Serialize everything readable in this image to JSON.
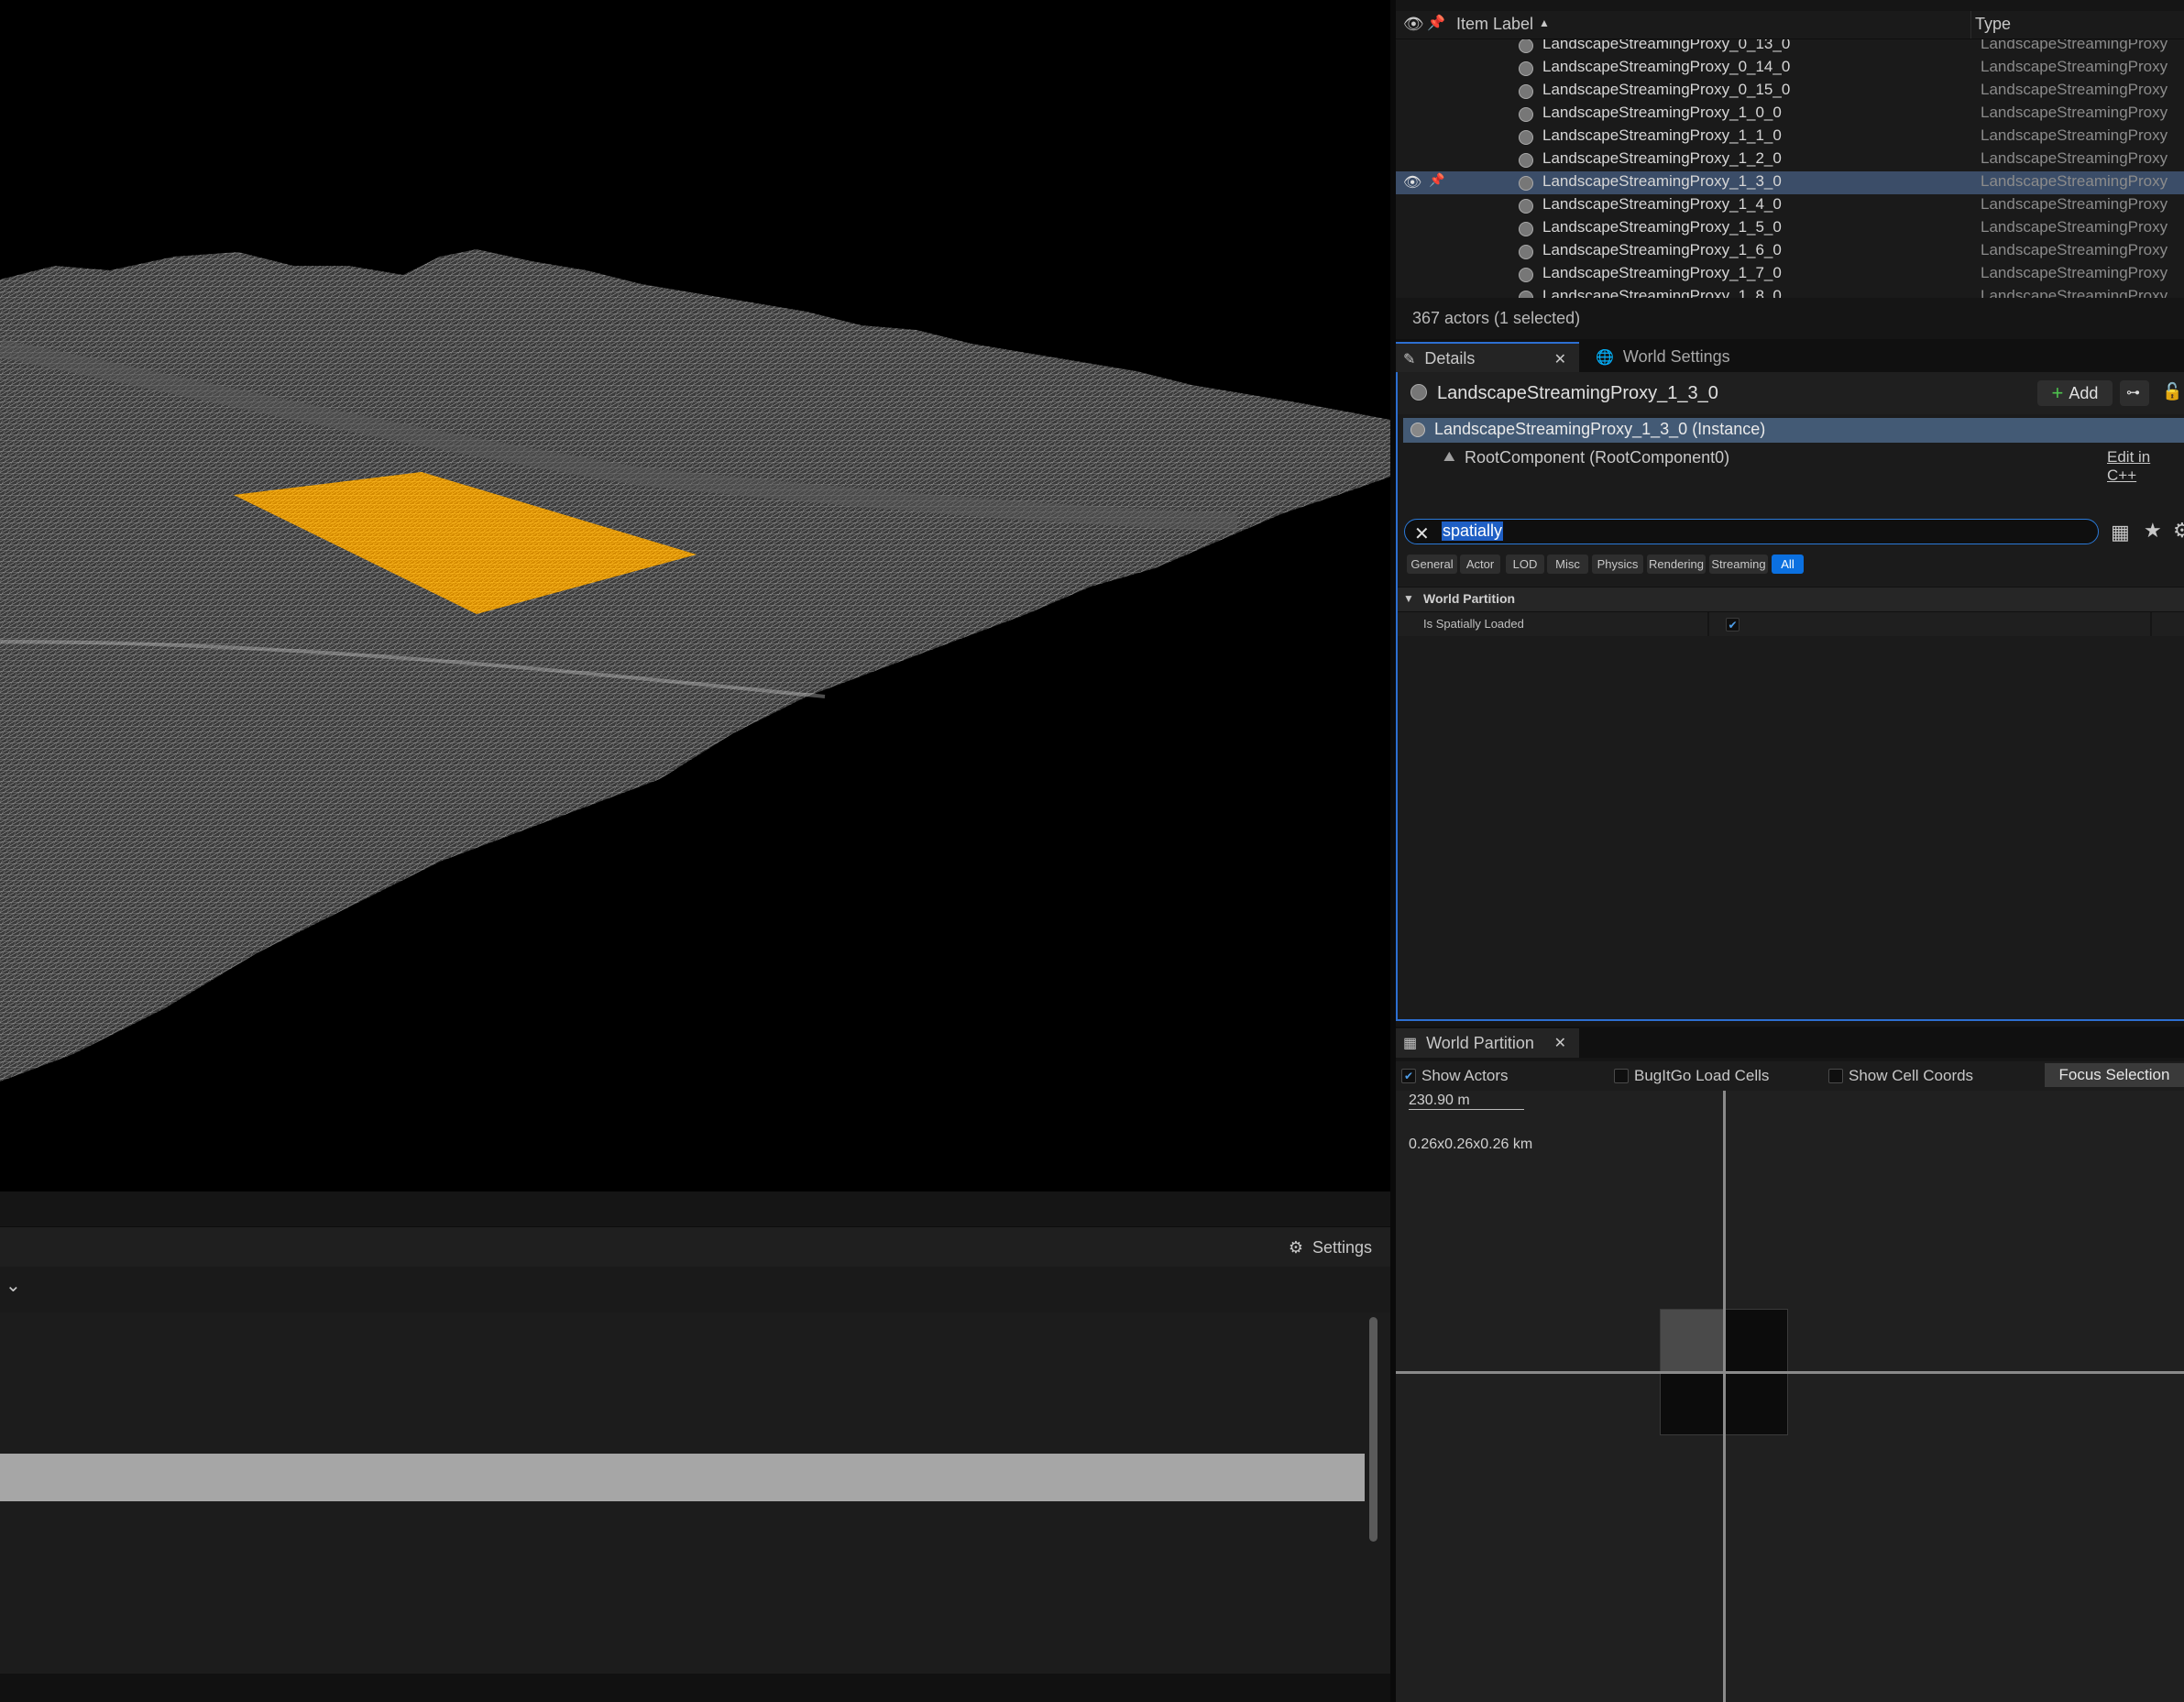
{
  "viewport": {
    "colors": {
      "wireframe": "#9a9a9a",
      "selection": "#f0a010",
      "background": "#000000"
    }
  },
  "bottom_panel": {
    "settings_label": "Settings",
    "filter_chevron": "⌄"
  },
  "outliner": {
    "col_item_label": "Item Label",
    "col_type": "Type",
    "rows": [
      {
        "label": "LandscapeStreamingProxy_0_13_0",
        "type": "LandscapeStreamingProxy"
      },
      {
        "label": "LandscapeStreamingProxy_0_14_0",
        "type": "LandscapeStreamingProxy"
      },
      {
        "label": "LandscapeStreamingProxy_0_15_0",
        "type": "LandscapeStreamingProxy"
      },
      {
        "label": "LandscapeStreamingProxy_1_0_0",
        "type": "LandscapeStreamingProxy"
      },
      {
        "label": "LandscapeStreamingProxy_1_1_0",
        "type": "LandscapeStreamingProxy"
      },
      {
        "label": "LandscapeStreamingProxy_1_2_0",
        "type": "LandscapeStreamingProxy"
      },
      {
        "label": "LandscapeStreamingProxy_1_3_0",
        "type": "LandscapeStreamingProxy"
      },
      {
        "label": "LandscapeStreamingProxy_1_4_0",
        "type": "LandscapeStreamingProxy"
      },
      {
        "label": "LandscapeStreamingProxy_1_5_0",
        "type": "LandscapeStreamingProxy"
      },
      {
        "label": "LandscapeStreamingProxy_1_6_0",
        "type": "LandscapeStreamingProxy"
      },
      {
        "label": "LandscapeStreamingProxy_1_7_0",
        "type": "LandscapeStreamingProxy"
      },
      {
        "label": "LandscapeStreamingProxy_1_8_0",
        "type": "LandscapeStreamingProxy"
      }
    ],
    "footer": "367 actors (1 selected)"
  },
  "details": {
    "tab_details": "Details",
    "tab_world_settings": "World Settings",
    "actor_name": "LandscapeStreamingProxy_1_3_0",
    "add_label": "Add",
    "component_instance": "LandscapeStreamingProxy_1_3_0 (Instance)",
    "component_root": "RootComponent (RootComponent0)",
    "edit_cpp": "Edit in C++",
    "search_value": "spatially",
    "filters": [
      "General",
      "Actor",
      "LOD",
      "Misc",
      "Physics",
      "Rendering",
      "Streaming",
      "All"
    ],
    "category": "World Partition",
    "property_name": "Is Spatially Loaded",
    "property_checked": true
  },
  "world_partition": {
    "tab_label": "World Partition",
    "show_actors": "Show Actors",
    "bugitgo": "BugItGo Load Cells",
    "show_cell_coords": "Show Cell Coords",
    "focus_selection": "Focus Selection",
    "scale_text": "230.90 m",
    "size_text": "0.26x0.26x0.26 km"
  }
}
